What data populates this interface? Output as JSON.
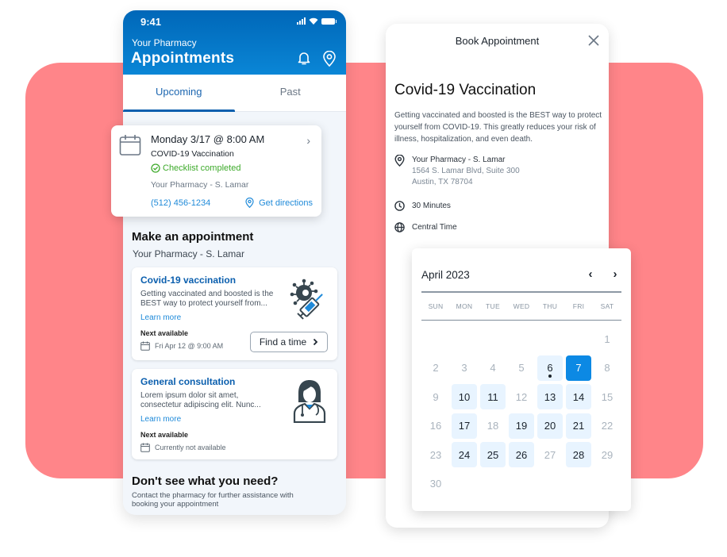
{
  "colors": {
    "brand_blue": "#0067b8",
    "link_blue": "#1f8ad9",
    "success_green": "#3daa2a",
    "accent_pink": "#ff8589",
    "selected_day": "#0c89e4",
    "available_day": "#e8f4ff"
  },
  "phone": {
    "status_time": "9:41",
    "pharmacy_label": "Your Pharmacy",
    "title": "Appointments",
    "header_icons": [
      "bell-icon",
      "location-pin-icon"
    ],
    "tabs": [
      {
        "label": "Upcoming",
        "active": true
      },
      {
        "label": "Past",
        "active": false
      }
    ],
    "upcoming": {
      "when": "Monday 3/17 @ 8:00 AM",
      "type": "COVID-19 Vaccination",
      "checklist": "Checklist completed",
      "location": "Your Pharmacy - S. Lamar",
      "phone": "(512) 456-1234",
      "directions": "Get directions"
    },
    "make_appointment": {
      "title": "Make an appointment",
      "location": "Your Pharmacy - S. Lamar"
    },
    "services": [
      {
        "title": "Covid-19 vaccination",
        "desc": "Getting vaccinated and boosted is the BEST way to protect yourself from...",
        "learn_more": "Learn more",
        "next_label": "Next available",
        "next_value": "Fri Apr 12 @ 9:00 AM",
        "button": "Find a time",
        "icon": "virus-vaccine-icon"
      },
      {
        "title": "General consultation",
        "desc": "Lorem ipsum dolor sit amet, consectetur adipiscing elit. Nunc...",
        "learn_more": "Learn more",
        "next_label": "Next available",
        "next_value": "Currently not available",
        "icon": "doctor-icon"
      }
    ],
    "footer": {
      "title": "Don't see what you need?",
      "text": "Contact the pharmacy for further assistance with booking your appointment"
    }
  },
  "book": {
    "title": "Book Appointment",
    "service": "Covid-19 Vaccination",
    "description": "Getting vaccinated and boosted is the BEST way to protect yourself from COVID-19. This greatly reduces your risk of illness, hospitalization, and even death.",
    "location_name": "Your Pharmacy - S. Lamar",
    "address_line1": "1564 S. Lamar Blvd, Suite 300",
    "address_line2": "Austin, TX 78704",
    "duration": "30 Minutes",
    "timezone": "Central Time"
  },
  "calendar": {
    "month_label": "April 2023",
    "prev": "‹",
    "next": "›",
    "weekdays": [
      "SUN",
      "MON",
      "TUE",
      "WED",
      "THU",
      "FRI",
      "SAT"
    ],
    "first_weekday_index": 6,
    "days_in_month": 30,
    "available_days": [
      6,
      10,
      11,
      13,
      14,
      17,
      19,
      20,
      21,
      24,
      25,
      26,
      28
    ],
    "selected_day": 7,
    "today_marker_day": 6
  }
}
